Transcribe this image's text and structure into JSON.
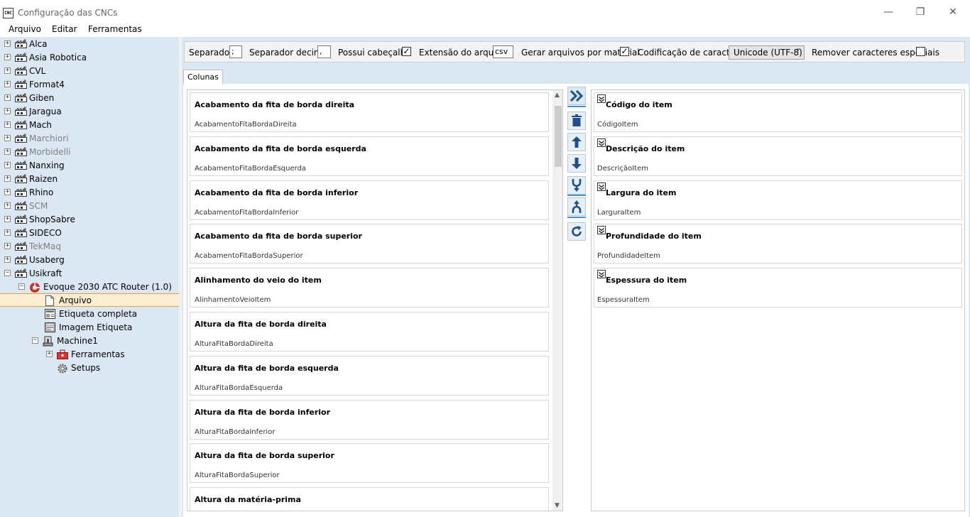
{
  "window": {
    "title": "Configuração das CNCs",
    "app_icon_text": "CNC",
    "minimize": "—",
    "maximize": "❐",
    "close": "✕"
  },
  "menu": [
    "Arquivo",
    "Editar",
    "Ferramentas"
  ],
  "tree": {
    "machines": [
      {
        "label": "Alca",
        "dim": false
      },
      {
        "label": "Asia Robotica",
        "dim": false
      },
      {
        "label": "CVL",
        "dim": false
      },
      {
        "label": "Format4",
        "dim": false
      },
      {
        "label": "Giben",
        "dim": false
      },
      {
        "label": "Jaragua",
        "dim": false
      },
      {
        "label": "Mach",
        "dim": false
      },
      {
        "label": "Marchiori",
        "dim": true
      },
      {
        "label": "Morbidelli",
        "dim": true
      },
      {
        "label": "Nanxing",
        "dim": false
      },
      {
        "label": "Raizen",
        "dim": false
      },
      {
        "label": "Rhino",
        "dim": false
      },
      {
        "label": "SCM",
        "dim": true
      },
      {
        "label": "ShopSabre",
        "dim": false
      },
      {
        "label": "SIDECO",
        "dim": false
      },
      {
        "label": "TekMaq",
        "dim": true
      },
      {
        "label": "Usaberg",
        "dim": false
      },
      {
        "label": "Usikraft",
        "dim": false
      }
    ],
    "model": "Evoque 2030 ATC Router (1.0)",
    "model_children": [
      "Arquivo",
      "Etiqueta completa",
      "Imagem Etiqueta"
    ],
    "machine": "Machine1",
    "machine_children": [
      "Ferramentas",
      "Setups"
    ],
    "expander_plus": "+",
    "expander_minus": "−"
  },
  "toolbar": {
    "separator_label": "Separador",
    "separator_value": ";",
    "decimal_label": "Separador decimal",
    "decimal_value": ",",
    "header_label": "Possui cabeçalho",
    "header_checked": "✓",
    "extension_label": "Extensão do arquivo",
    "extension_value": "csv",
    "per_material_label": "Gerar arquivos por material",
    "per_material_checked": "✓",
    "encoding_label": "Codificação de caracteres",
    "encoding_value": "Unicode (UTF-8)",
    "encoding_arrow": "˅",
    "remove_special_label": "Remover caracteres especiais"
  },
  "tab": "Colunas",
  "available_columns": [
    {
      "title": "Acabamento da fita de borda direita",
      "key": "AcabamentoFitaBordaDireita"
    },
    {
      "title": "Acabamento da fita de borda esquerda",
      "key": "AcabamentoFitaBordaEsquerda"
    },
    {
      "title": "Acabamento da fita de borda inferior",
      "key": "AcabamentoFitaBordaInferior"
    },
    {
      "title": "Acabamento da fita de borda superior",
      "key": "AcabamentoFitaBordaSuperior"
    },
    {
      "title": "Alinhamento do veio do item",
      "key": "AlinhamentoVeioItem"
    },
    {
      "title": "Altura da fita de borda direita",
      "key": "AlturaFitaBordaDireita"
    },
    {
      "title": "Altura da fita de borda esquerda",
      "key": "AlturaFitaBordaEsquerda"
    },
    {
      "title": "Altura da fita de borda inferior",
      "key": "AlturaFitaBordaInferior"
    },
    {
      "title": "Altura da fita de borda superior",
      "key": "AlturaFitaBordaSuperior"
    },
    {
      "title": "Altura da matéria-prima",
      "key": ""
    }
  ],
  "selected_columns": [
    {
      "title": "Código do item",
      "key": "CódigoItem"
    },
    {
      "title": "Descrição do item",
      "key": "DescriçãoItem"
    },
    {
      "title": "Largura do item",
      "key": "LarguraItem"
    },
    {
      "title": "Profundidade do item",
      "key": "ProfundidadeItem"
    },
    {
      "title": "Espessura do item",
      "key": "EspessuraItem"
    }
  ],
  "actions": [
    "add-all",
    "delete",
    "move-up",
    "move-down",
    "merge",
    "split",
    "refresh"
  ],
  "colors": {
    "tree_bg": "#dce7f4",
    "accent": "#1e4f8a",
    "selection": "#fbeed3"
  }
}
